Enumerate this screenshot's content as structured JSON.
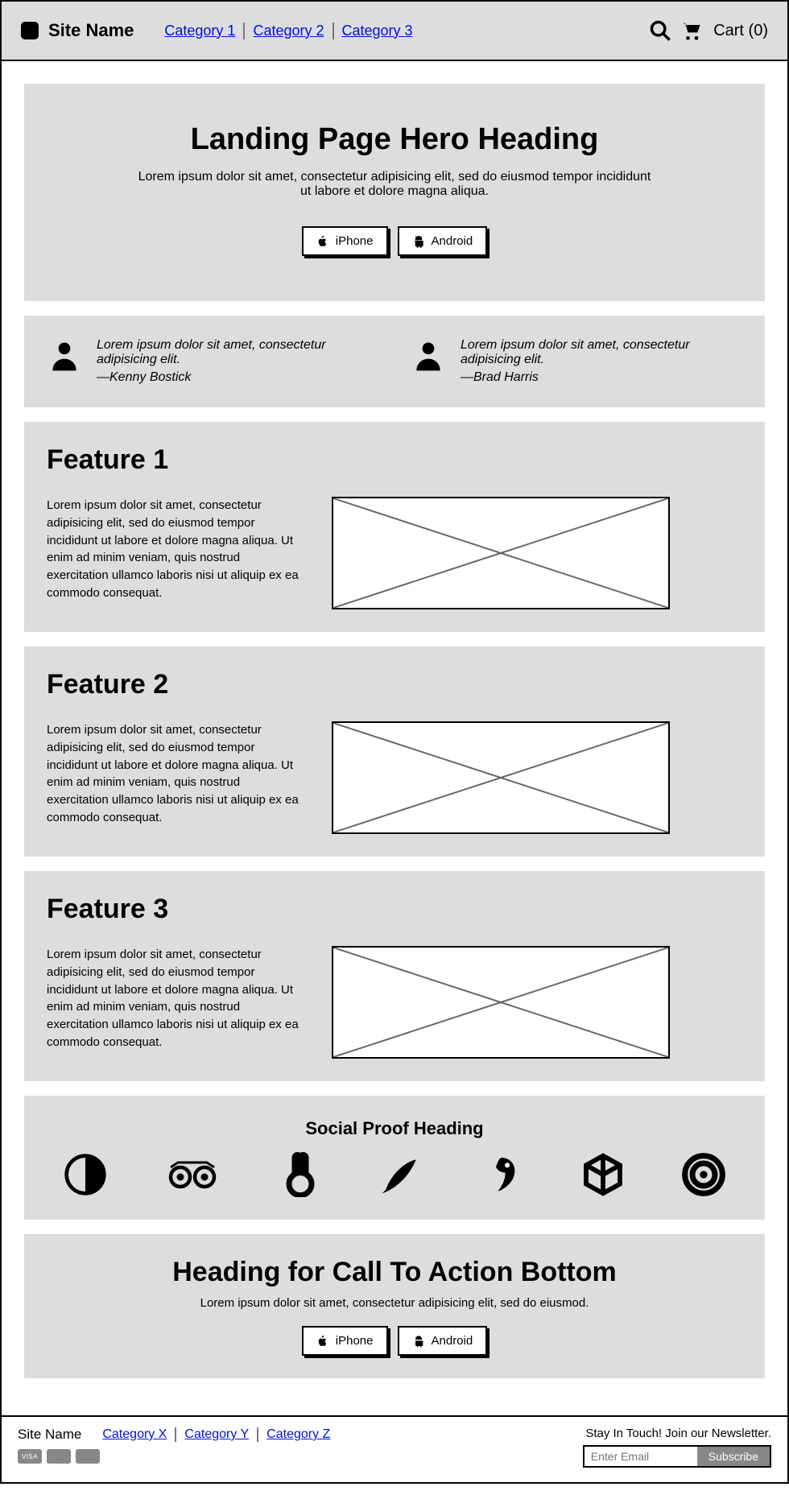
{
  "header": {
    "site_name": "Site Name",
    "nav": [
      "Category 1",
      "Category 2",
      "Category 3"
    ],
    "cart_label": "Cart (0)"
  },
  "hero": {
    "heading": "Landing Page Hero Heading",
    "subtext": "Lorem ipsum dolor sit amet, consectetur adipisicing elit, sed do eiusmod tempor incididunt ut labore et dolore magna aliqua.",
    "buttons": {
      "iphone": "iPhone",
      "android": "Android"
    }
  },
  "testimonials": [
    {
      "text": "Lorem ipsum dolor sit amet, consectetur adipisicing elit.",
      "author": "—Kenny Bostick"
    },
    {
      "text": "Lorem ipsum dolor sit amet, consectetur adipisicing elit.",
      "author": "—Brad Harris"
    }
  ],
  "features": [
    {
      "title": "Feature 1",
      "body": "Lorem ipsum dolor sit amet, consectetur adipisicing elit, sed do eiusmod tempor incididunt ut labore et dolore magna aliqua. Ut enim ad minim veniam, quis nostrud exercitation ullamco laboris nisi ut aliquip ex ea commodo consequat."
    },
    {
      "title": "Feature 2",
      "body": "Lorem ipsum dolor sit amet, consectetur adipisicing elit, sed do eiusmod tempor incididunt ut labore et dolore magna aliqua. Ut enim ad minim veniam, quis nostrud exercitation ullamco laboris nisi ut aliquip ex ea commodo consequat."
    },
    {
      "title": "Feature 3",
      "body": "Lorem ipsum dolor sit amet, consectetur adipisicing elit, sed do eiusmod tempor incididunt ut labore et dolore magna aliqua. Ut enim ad minim veniam, quis nostrud exercitation ullamco laboris nisi ut aliquip ex ea commodo consequat."
    }
  ],
  "social_proof": {
    "heading": "Social Proof Heading"
  },
  "cta": {
    "heading": "Heading for Call To Action Bottom",
    "subtext": "Lorem ipsum dolor sit amet, consectetur adipisicing elit, sed do eiusmod.",
    "buttons": {
      "iphone": "iPhone",
      "android": "Android"
    }
  },
  "footer": {
    "site_name": "Site Name",
    "nav": [
      "Category X",
      "Category Y",
      "Category Z"
    ],
    "pay_cards": [
      "VISA",
      "",
      ""
    ],
    "newsletter_label": "Stay In Touch! Join our Newsletter.",
    "email_placeholder": "Enter Email",
    "subscribe_label": "Subscribe"
  }
}
